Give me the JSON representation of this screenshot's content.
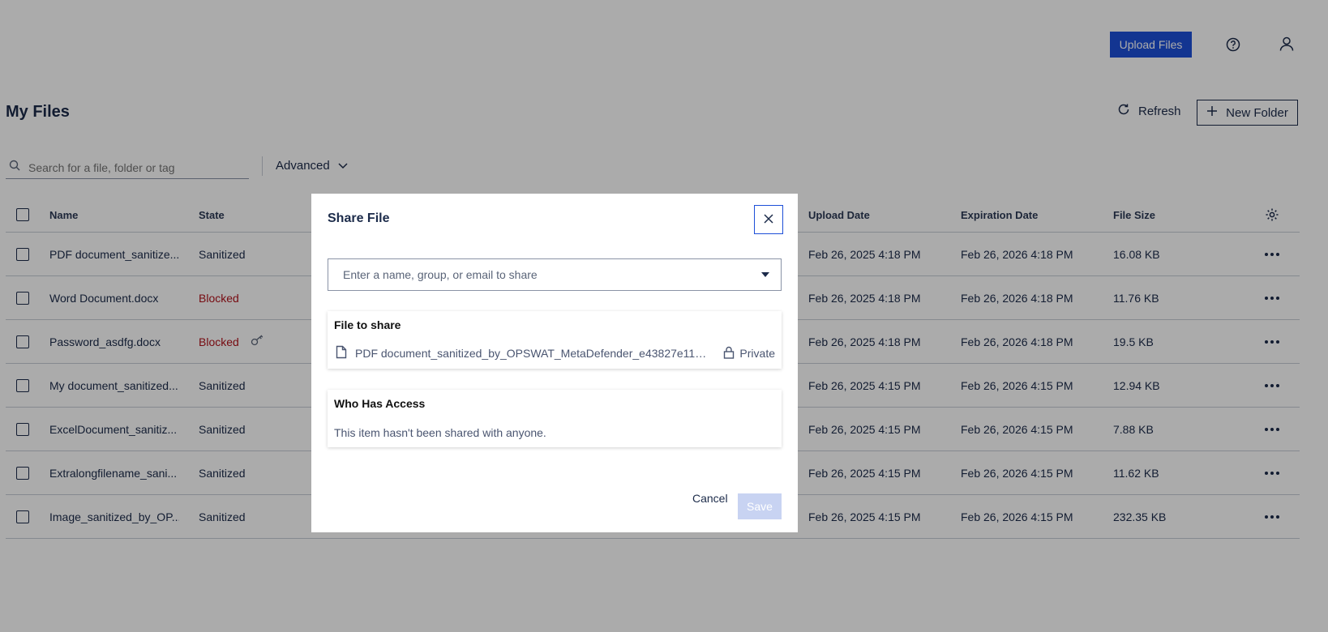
{
  "header": {
    "upload_label": "Upload Files"
  },
  "page": {
    "title": "My Files",
    "refresh_label": "Refresh",
    "new_folder_label": "New Folder"
  },
  "search": {
    "placeholder": "Search for a file, folder or tag",
    "advanced_label": "Advanced"
  },
  "table": {
    "columns": {
      "name": "Name",
      "state": "State",
      "upload": "Upload Date",
      "expiration": "Expiration Date",
      "size": "File Size"
    },
    "rows": [
      {
        "name": "PDF document_sanitize...",
        "state": "Sanitized",
        "upload": "Feb 26, 2025 4:18 PM",
        "expiration": "Feb 26, 2026 4:18 PM",
        "size": "16.08 KB"
      },
      {
        "name": "Word Document.docx",
        "state": "Blocked",
        "upload": "Feb 26, 2025 4:18 PM",
        "expiration": "Feb 26, 2026 4:18 PM",
        "size": "11.76 KB"
      },
      {
        "name": "Password_asdfg.docx",
        "state": "Blocked",
        "upload": "Feb 26, 2025 4:18 PM",
        "expiration": "Feb 26, 2026 4:18 PM",
        "size": "19.5 KB"
      },
      {
        "name": "My document_sanitized...",
        "state": "Sanitized",
        "upload": "Feb 26, 2025 4:15 PM",
        "expiration": "Feb 26, 2026 4:15 PM",
        "size": "12.94 KB"
      },
      {
        "name": "ExcelDocument_sanitiz...",
        "state": "Sanitized",
        "upload": "Feb 26, 2025 4:15 PM",
        "expiration": "Feb 26, 2026 4:15 PM",
        "size": "7.88 KB"
      },
      {
        "name": "Extralongfilename_sani...",
        "state": "Sanitized",
        "upload": "Feb 26, 2025 4:15 PM",
        "expiration": "Feb 26, 2026 4:15 PM",
        "size": "11.62 KB"
      },
      {
        "name": "Image_sanitized_by_OP...",
        "state": "Sanitized",
        "upload": "Feb 26, 2025 4:15 PM",
        "expiration": "Feb 26, 2026 4:15 PM",
        "size": "232.35 KB"
      }
    ]
  },
  "modal": {
    "title": "Share File",
    "share_placeholder": "Enter a name, group, or email to share",
    "file_to_share_heading": "File to share",
    "file_name": "PDF document_sanitized_by_OPSWAT_MetaDefender_e43827e11dfa...",
    "privacy_label": "Private",
    "access_heading": "Who Has Access",
    "access_text": "This item hasn't been shared with anyone.",
    "cancel_label": "Cancel",
    "save_label": "Save"
  },
  "colors": {
    "primary": "#1d4fd8",
    "blocked": "#b2121c",
    "text": "#1c2b4a",
    "save_disabled": "#c8d3f2"
  }
}
